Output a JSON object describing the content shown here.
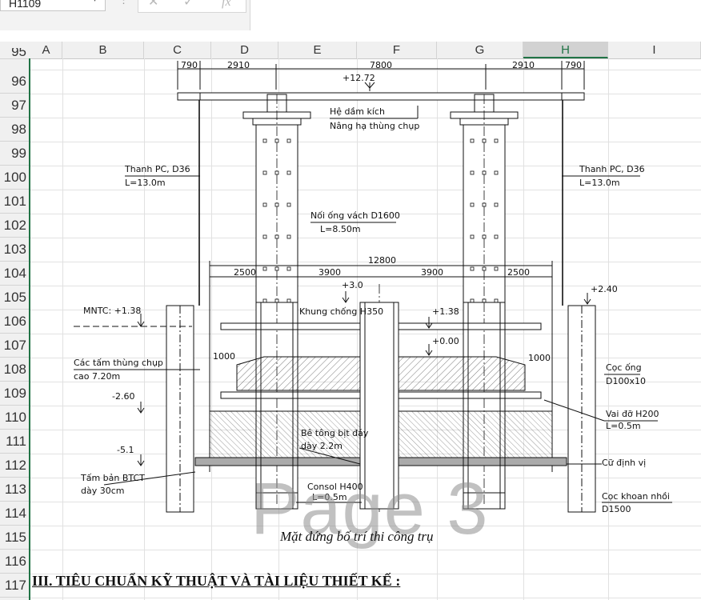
{
  "formula_bar": {
    "name_box": "H1109",
    "cancel_icon": "✕",
    "enter_icon": "✓",
    "fx_label": "fx",
    "formula_value": ""
  },
  "columns": [
    "A",
    "B",
    "C",
    "D",
    "E",
    "F",
    "G",
    "H",
    "I"
  ],
  "selected_column": "H",
  "rows": [
    "95",
    "96",
    "97",
    "98",
    "99",
    "100",
    "101",
    "102",
    "103",
    "104",
    "105",
    "106",
    "107",
    "108",
    "109",
    "110",
    "111",
    "112",
    "113",
    "114",
    "115",
    "116",
    "117"
  ],
  "drawing": {
    "dim_top": [
      "790",
      "2910",
      "7800",
      "2910",
      "790"
    ],
    "elev_top": "+12.72",
    "note_beam": "Hệ dầm kích",
    "note_lift": "Nâng hạ thùng chụp",
    "rod_left": "Thanh PC, D36",
    "rod_left_len": "L=13.0m",
    "rod_right": "Thanh PC, D36",
    "rod_right_len": "L=13.0m",
    "casing_ext": "Nối ống vách D1600",
    "casing_ext_len": "L=8.50m",
    "dim_total": "12800",
    "dim_mid": [
      "2500",
      "3900",
      "3900",
      "2500"
    ],
    "elev_plus3": "+3.0",
    "elev_plus240": "+2.40",
    "mntc": "MNTC: +1.38",
    "frame": "Khung chống H350",
    "elev_138": "+1.38",
    "elev_000": "+0.00",
    "dim_1000_left": "1000",
    "dim_1000_right": "1000",
    "panels": "Các tấm thùng chụp",
    "panels_height": "cao 7.20m",
    "pipe_pile": "Cọc ống",
    "pipe_pile_size": "D100x10",
    "elev_260": "-2.60",
    "support": "Vai đỡ H200",
    "support_len": "L=0.5m",
    "concrete": "Bê tông bịt đáy",
    "concrete_thick": "dày 2.2m",
    "elev_51": "-5.1",
    "guide": "Cữ định vị",
    "slab": "Tấm bản BTCT",
    "slab_thick": "dày 30cm",
    "bracket": "Consol H400",
    "bracket_len": "L=0.5m",
    "bored_pile": "Cọc khoan nhồi",
    "bored_pile_size": "D1500"
  },
  "page_watermark": "Page 3",
  "caption": "Mặt đứng bố trí thi công trụ",
  "heading": "III. TIÊU CHUẨN KỸ THUẬT VÀ TÀI LIỆU THIẾT KẾ :",
  "accent_color": "#217346"
}
